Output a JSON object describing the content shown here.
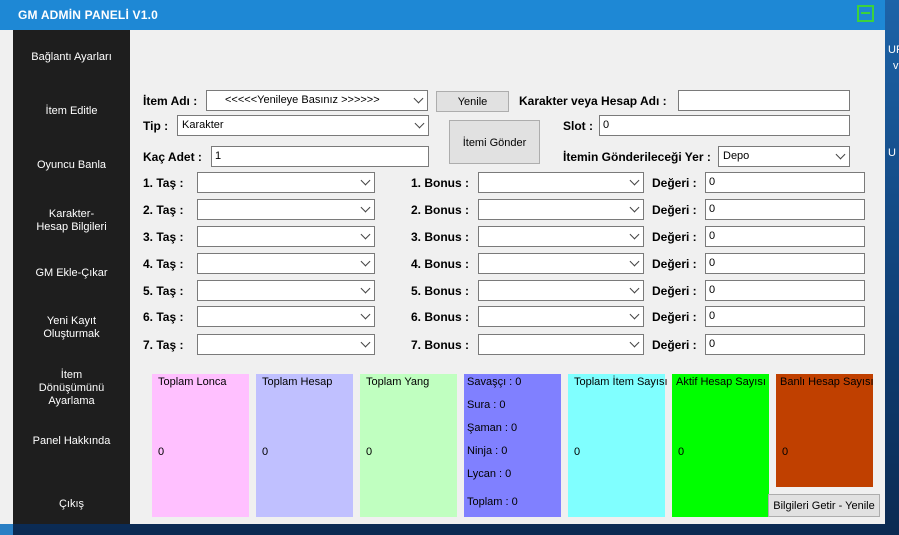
{
  "window": {
    "title": "GM ADMİN PANELİ  V1.0"
  },
  "desktop": {
    "right_text_1": "UF",
    "right_text_2": "v",
    "right_text_3": "U"
  },
  "sidebar": {
    "items": [
      {
        "label": "Bağlantı Ayarları"
      },
      {
        "label": "İtem Editle"
      },
      {
        "label": "Oyuncu Banla"
      },
      {
        "label": "Karakter-Hesap Bilgileri"
      },
      {
        "label": "GM Ekle-Çıkar"
      },
      {
        "label": "Yeni Kayıt Oluşturmak"
      },
      {
        "label": "İtem Dönüşümünü Ayarlama"
      },
      {
        "label": "Panel Hakkında"
      },
      {
        "label": "Çıkış"
      }
    ]
  },
  "form": {
    "item_name_label": "İtem Adı :",
    "item_name_value": "<<<<<Yenileye Basınız >>>>>>",
    "refresh_button": "Yenile",
    "account_label": "Karakter veya Hesap Adı :",
    "account_value": "",
    "type_label": "Tip :",
    "type_value": "Karakter",
    "send_button": "İtemi Gönder",
    "slot_label": "Slot :",
    "slot_value": "0",
    "count_label": "Kaç Adet :",
    "count_value": "1",
    "destination_label": "İtemin Gönderileceği Yer :",
    "destination_value": "Depo",
    "stones": [
      {
        "label": "1. Taş :",
        "value": ""
      },
      {
        "label": "2. Taş :",
        "value": ""
      },
      {
        "label": "3. Taş :",
        "value": ""
      },
      {
        "label": "4. Taş :",
        "value": ""
      },
      {
        "label": "5. Taş :",
        "value": ""
      },
      {
        "label": "6. Taş :",
        "value": ""
      },
      {
        "label": "7. Taş :",
        "value": ""
      }
    ],
    "bonuses": [
      {
        "label": "1. Bonus :",
        "value": "",
        "value_label": "Değeri :",
        "amount": "0"
      },
      {
        "label": "2. Bonus :",
        "value": "",
        "value_label": "Değeri :",
        "amount": "0"
      },
      {
        "label": "3. Bonus :",
        "value": "",
        "value_label": "Değeri :",
        "amount": "0"
      },
      {
        "label": "4. Bonus :",
        "value": "",
        "value_label": "Değeri :",
        "amount": "0"
      },
      {
        "label": "5. Bonus :",
        "value": "",
        "value_label": "Değeri :",
        "amount": "0"
      },
      {
        "label": "6. Bonus :",
        "value": "",
        "value_label": "Değeri :",
        "amount": "0"
      },
      {
        "label": "7. Bonus :",
        "value": "",
        "value_label": "Değeri :",
        "amount": "0"
      }
    ]
  },
  "stats": {
    "guilds": {
      "title": "Toplam Lonca",
      "value": "0",
      "color": "#ffc0ff"
    },
    "accounts": {
      "title": "Toplam Hesap",
      "value": "0",
      "color": "#c0c0ff"
    },
    "yang": {
      "title": "Toplam Yang",
      "value": "0",
      "color": "#c0ffc0"
    },
    "classes": {
      "color": "#8080ff",
      "warrior": "Savaşçı : 0",
      "sura": "Sura :  0",
      "shaman": "Şaman :  0",
      "ninja": "Ninja : 0",
      "lycan": "Lycan : 0",
      "total": "Toplam :  0"
    },
    "items": {
      "title": "Toplam İtem Sayısı",
      "value": "0",
      "color": "#80ffff"
    },
    "active": {
      "title": "Aktif Hesap Sayısı",
      "value": "0",
      "color": "#00ff00"
    },
    "banned": {
      "title": "Banlı Hesap Sayısı",
      "value": "0",
      "color": "#c04000"
    },
    "refresh_button": "Bilgileri Getir - Yenile"
  }
}
